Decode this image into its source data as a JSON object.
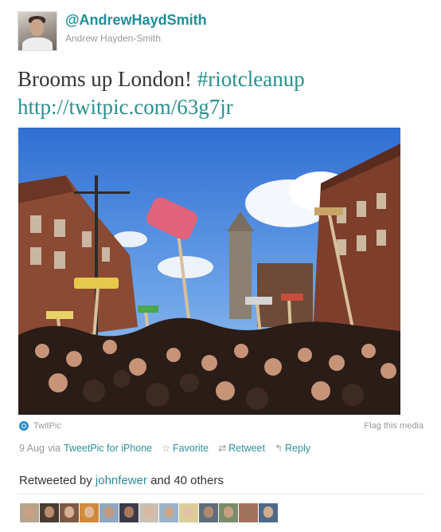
{
  "tweet": {
    "handle": "@AndrewHaydSmith",
    "real_name": "Andrew Hayden-Smith",
    "text_main": "Brooms up London! ",
    "hashtag": "#riotcleanup",
    "link": "http://twitpic.com/63g7jr"
  },
  "media": {
    "service_label": "TwitPic",
    "flag_label": "Flag this media",
    "description": ""
  },
  "meta": {
    "date": "9 Aug",
    "via_prefix": "via",
    "via_app": "TweetPic for iPhone",
    "favorite_label": "Favorite",
    "retweet_label": "Retweet",
    "reply_label": "Reply"
  },
  "retweets": {
    "prefix": "Retweeted by",
    "user": "johnfewer",
    "suffix": "and 40 others",
    "avatar_count": 13
  },
  "colors": {
    "link": "#2a8f9a",
    "handle": "#1a8f9a",
    "muted": "#999999",
    "sky": "#4f86d6"
  },
  "icons": {
    "service": "twitpic-icon",
    "favorite": "star-icon",
    "retweet": "retweet-icon",
    "reply": "reply-arrow-icon"
  }
}
